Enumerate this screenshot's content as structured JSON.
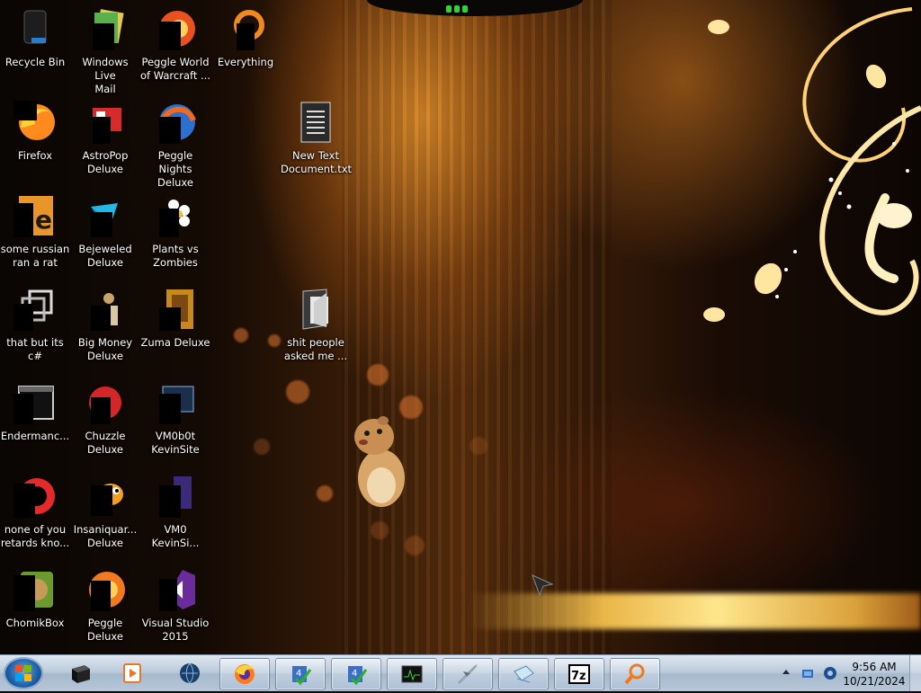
{
  "desktop": {
    "icons": [
      {
        "label": "Recycle Bin"
      },
      {
        "label": "Windows Live\nMail"
      },
      {
        "label": "Peggle World\nof Warcraft ..."
      },
      {
        "label": "Everything"
      },
      {
        "label": "Firefox"
      },
      {
        "label": "AstroPop\nDeluxe"
      },
      {
        "label": "Peggle Nights\nDeluxe"
      },
      {
        "label": "New Text\nDocument.txt"
      },
      {
        "label": "some russian\nran a rat"
      },
      {
        "label": "Bejeweled\nDeluxe"
      },
      {
        "label": "Plants vs\nZombies"
      },
      {
        "label": "that but its c#"
      },
      {
        "label": "Big Money\nDeluxe"
      },
      {
        "label": "Zuma Deluxe"
      },
      {
        "label": "shit people\nasked me ..."
      },
      {
        "label": "Endermanc..."
      },
      {
        "label": "Chuzzle\nDeluxe"
      },
      {
        "label": "VM0b0t\nKevinSite"
      },
      {
        "label": "none of you\nretards kno..."
      },
      {
        "label": "Insaniquar...\nDeluxe"
      },
      {
        "label": "VM0\nKevinSi..."
      },
      {
        "label": "ChomikBox"
      },
      {
        "label": "Peggle Deluxe"
      },
      {
        "label": "Visual Studio\n2015"
      }
    ]
  },
  "taskbar": {
    "start_icon": "windows-orb",
    "pinned": [
      "terminal-icon",
      "media-player-icon",
      "globe-icon",
      "firefox-icon",
      "checkmark-app-icon",
      "checkmark-app-icon-2",
      "monitor-icon",
      "plane-icon",
      "notepad-icon",
      "7zip-icon",
      "search-everything-icon"
    ],
    "clock": {
      "time": "9:56 AM",
      "date": "10/21/2024"
    }
  },
  "colors": {
    "accent_orange": "#e8782a",
    "taskbar_top": "#dfe7f0",
    "taskbar_bottom": "#a7b9cd",
    "glow": "#ffd27a"
  }
}
